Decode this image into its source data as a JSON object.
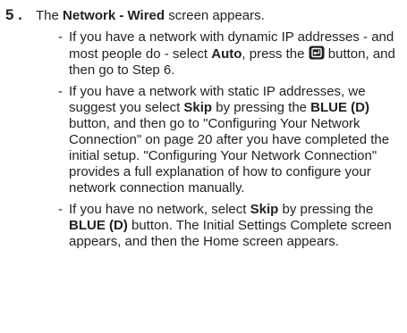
{
  "step": {
    "number": "5 .",
    "intro_before": "The ",
    "intro_bold": "Network - Wired",
    "intro_after": " screen appears."
  },
  "bullets": [
    {
      "dash": "-",
      "t1": "If you have a network with dynamic IP addresses - and most people do - select ",
      "b1": "Auto",
      "t2": ", press the ",
      "icon": "enter-button-icon",
      "t3": " button, and then go to Step 6."
    },
    {
      "dash": "-",
      "t1": "If you have a network with static IP addresses, we suggest you select ",
      "b1": "Skip",
      "t2": " by pressing the ",
      "b2": "BLUE (D)",
      "t3": " button, and then go to \"Configuring Your Network Connection\" on page 20 after you have completed the initial setup. \"Configuring Your Network Connection\" provides a full explanation of how to configure your network connection manually."
    },
    {
      "dash": "-",
      "t1": "If you have no network, select ",
      "b1": "Skip",
      "t2": " by pressing the ",
      "b2": "BLUE (D)",
      "t3": " button. The Initial Settings Complete screen appears, and then the Home screen appears."
    }
  ]
}
